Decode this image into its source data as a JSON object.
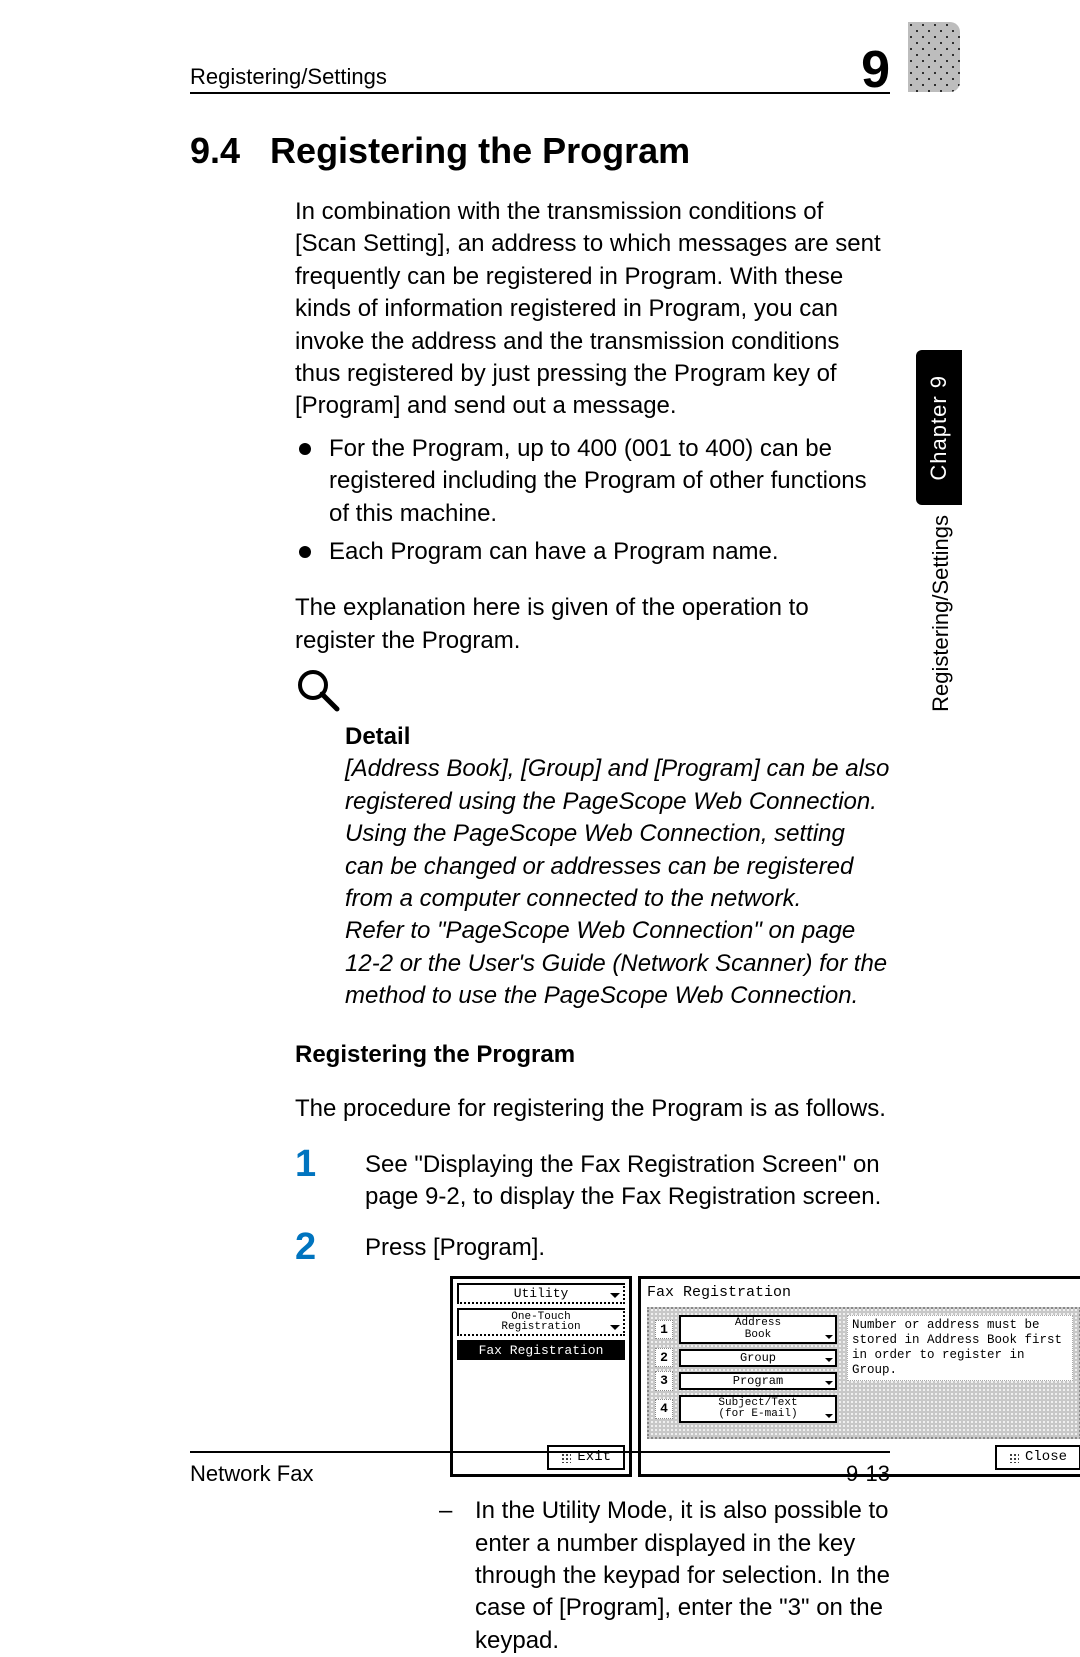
{
  "running_header": {
    "section_name": "Registering/Settings",
    "chapter_digit": "9"
  },
  "side_tab": {
    "chapter_label": "Chapter 9",
    "section_label": "Registering/Settings"
  },
  "section": {
    "number": "9.4",
    "title": "Registering the Program"
  },
  "intro_paragraph": "In combination with the transmission conditions of [Scan Setting], an address to which messages are sent frequently can be registered in Program. With these kinds of information registered in Program, you can invoke the address and the transmission conditions thus registered by just pressing the Program key of [Program] and send out a message.",
  "intro_bullets": [
    "For the Program, up to 400 (001 to 400) can be registered including the Program of other functions of this machine.",
    "Each Program can have a Program name."
  ],
  "intro_followup": "The explanation here is given of the operation to register the Program.",
  "detail": {
    "heading": "Detail",
    "para1": "[Address Book], [Group] and [Program] can be also registered using the PageScope Web Connection. Using the PageScope Web Connection, setting can be changed or addresses can be registered from a computer connected to the network.",
    "para2": "Refer to \"PageScope Web Connection\" on page 12-2 or the User's Guide (Network Scanner) for the method to use the PageScope Web Connection."
  },
  "subhead": "Registering the Program",
  "procedure_intro": "The procedure for registering the Program is as follows.",
  "steps": [
    {
      "text": "See \"Displaying the Fax Registration Screen\" on page 9-2, to display the Fax Registration screen."
    },
    {
      "text": "Press [Program].",
      "subnote": "In the Utility Mode, it is also possible to enter a number displayed in the key through the keypad for selection. In the case of [Program], enter the \"3\" on the keypad."
    }
  ],
  "lcd": {
    "breadcrumbs": [
      {
        "lines": [
          "Utility"
        ],
        "active": false
      },
      {
        "lines": [
          "One-Touch",
          "Registration"
        ],
        "active": false
      },
      {
        "lines": [
          "Fax Registration"
        ],
        "active": true
      }
    ],
    "exit_label": "Exit",
    "screen_title": "Fax Registration",
    "menu": [
      {
        "index": "1",
        "lines": [
          "Address",
          "Book"
        ]
      },
      {
        "index": "2",
        "lines": [
          "Group"
        ]
      },
      {
        "index": "3",
        "lines": [
          "Program"
        ]
      },
      {
        "index": "4",
        "lines": [
          "Subject/Text",
          "(for E-mail)"
        ]
      }
    ],
    "hint_text": "Number or address must be stored in Address Book first in order to register in Group.",
    "close_label": "Close"
  },
  "footer": {
    "doc_name": "Network Fax",
    "page_number": "9-13"
  }
}
